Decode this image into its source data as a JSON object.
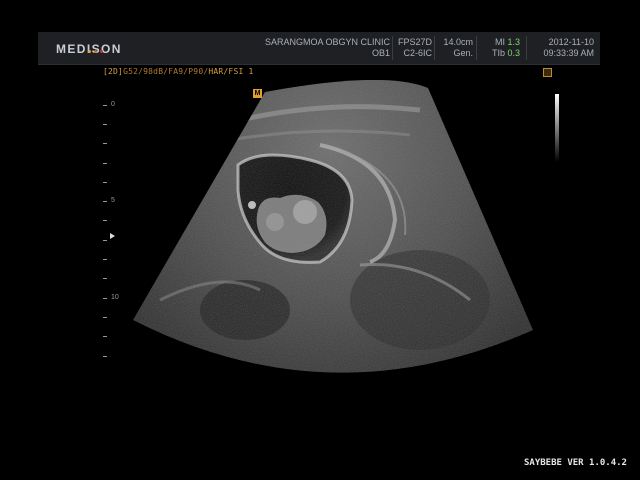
{
  "header": {
    "brand": "MEDISON",
    "brand_dot_colors": [
      "#d9a43a",
      "#e0662c",
      "#c83b2a"
    ],
    "clinic": "SARANGMOA OBGYN CLINIC",
    "preset": "OB1",
    "fps": "FPS27D",
    "probe": "C2-6IC",
    "depth": "14.0cm",
    "gen": "Gen.",
    "mi_label": "MI",
    "mi_value": "1.3",
    "tib_label": "TIb",
    "tib_value": "0.3",
    "date": "2012-11-10",
    "time": "09:33:39 AM"
  },
  "mode_line": {
    "mode": "[2D]",
    "params": "G52/98dB/FA9/P90/",
    "suffix": "HAR/FSI 1"
  },
  "markers": {
    "orientation": "M"
  },
  "depth_scale": {
    "labels": [
      "0",
      "5",
      "10"
    ]
  },
  "footer": {
    "version": "SAYBEBE VER 1.0.4.2"
  },
  "colors": {
    "accent_orange": "#d0a040",
    "green_value": "#7fd66a",
    "header_bg": "#1e2024"
  },
  "icons": [
    "brand-dots-icon",
    "orientation-marker-icon",
    "focus-marker-icon",
    "grayscale-bar-icon"
  ]
}
